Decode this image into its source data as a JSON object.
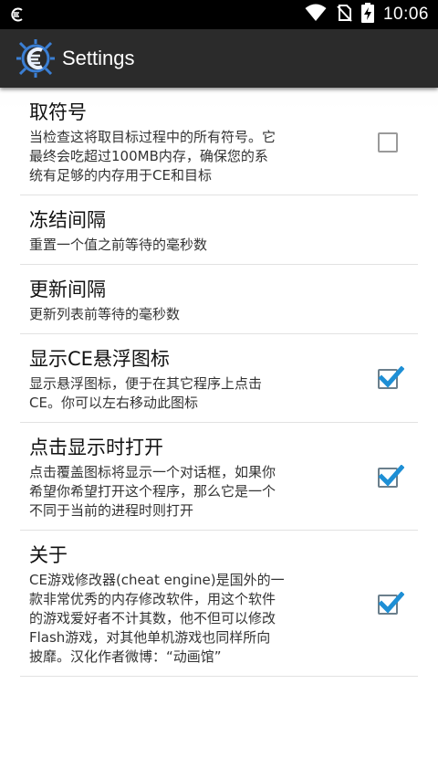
{
  "status_bar": {
    "time": "10:06",
    "icons": [
      "app-notification-icon",
      "wifi-icon",
      "no-sim-icon",
      "battery-charging-icon"
    ]
  },
  "action_bar": {
    "title": "Settings",
    "icon": "cheat-engine-logo"
  },
  "colors": {
    "action_bar": "#2b2b2b",
    "status_bar": "#000000",
    "check_accent": "#1e8fd5"
  },
  "preferences": [
    {
      "title": "取符号",
      "summary_lines": [
        "当检查这将取目标过程中的所有符号。它",
        "最终会吃超过100MB内存，确保您的系",
        "统有足够的内存用于CE和目标"
      ],
      "checkbox": true,
      "checked": false
    },
    {
      "title": "冻结间隔",
      "summary_lines": [
        "重置一个值之前等待的毫秒数"
      ],
      "checkbox": false
    },
    {
      "title": "更新间隔",
      "summary_lines": [
        "更新列表前等待的毫秒数"
      ],
      "checkbox": false
    },
    {
      "title": "显示CE悬浮图标",
      "summary_lines": [
        "显示悬浮图标，便于在其它程序上点击",
        "CE。你可以左右移动此图标"
      ],
      "checkbox": true,
      "checked": true
    },
    {
      "title": "点击显示时打开",
      "summary_lines": [
        "点击覆盖图标将显示一个对话框，如果你",
        "希望你希望打开这个程序，那么它是一个",
        "不同于当前的进程时则打开"
      ],
      "checkbox": true,
      "checked": true
    },
    {
      "title": "关于",
      "summary_lines": [
        "CE游戏修改器(cheat engine)是国外的一",
        "款非常优秀的内存修改软件，用这个软件",
        "的游戏爱好者不计其数，他不但可以修改",
        "Flash游戏，对其他单机游戏也同样所向",
        "披靡。汉化作者微博：“动画馆”"
      ],
      "checkbox": true,
      "checked": true
    }
  ]
}
